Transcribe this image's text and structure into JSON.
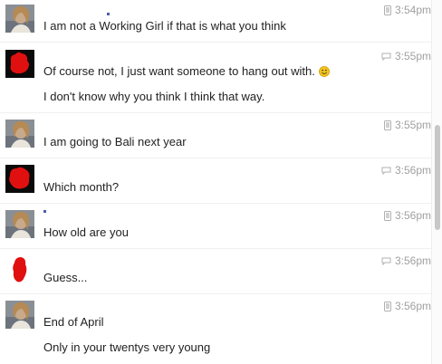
{
  "messages": [
    {
      "sender": "her",
      "device": "phone",
      "time": "3:54pm",
      "lines": [
        "I  am  not a Working  Girl if that  is what  you  think"
      ]
    },
    {
      "sender": "me",
      "device": "chat",
      "time": "3:55pm",
      "lines": [
        "Of course not, I just want someone to hang out with.",
        "I don't know why you think I think that way."
      ],
      "emoji": "smiley-emoji"
    },
    {
      "sender": "her",
      "device": "phone",
      "time": "3:55pm",
      "lines": [
        "I  am  going  to Bali  next  year"
      ]
    },
    {
      "sender": "me",
      "device": "chat",
      "time": "3:56pm",
      "lines": [
        "Which month?"
      ]
    },
    {
      "sender": "her",
      "device": "phone",
      "time": "3:56pm",
      "lines": [
        "How  old  are  you"
      ]
    },
    {
      "sender": "me",
      "device": "chat",
      "time": "3:56pm",
      "lines": [
        "Guess..."
      ]
    },
    {
      "sender": "her",
      "device": "phone",
      "time": "3:56pm",
      "lines": [
        "End  of April",
        "Only  in  your  twentys  very  young"
      ]
    }
  ],
  "colors": {
    "time": "#a0a0a0",
    "text": "#222222",
    "redacted": "#e01010",
    "scroll_thumb": "#c7c7c7"
  }
}
